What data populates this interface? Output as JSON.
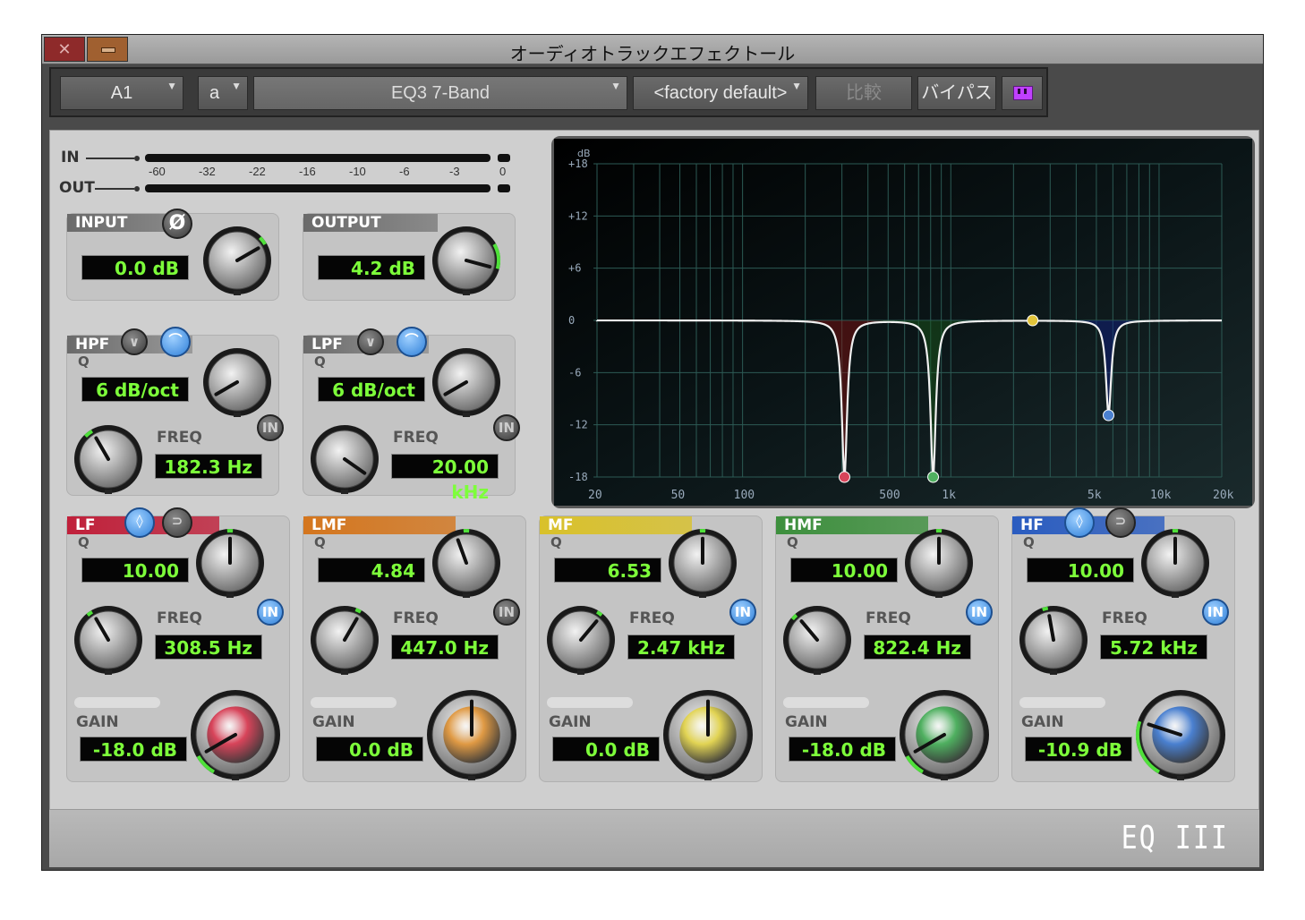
{
  "window": {
    "title": "オーディオトラックエフェクトール",
    "close_glyph": "✕"
  },
  "toolbar": {
    "track": "A1",
    "slot": "a",
    "plugin": "EQ3 7-Band",
    "preset": "<factory default>",
    "compare": "比較",
    "bypass": "バイパス"
  },
  "meter": {
    "in_label": "IN",
    "out_label": "OUT",
    "ticks": [
      "-60",
      "-32",
      "-22",
      "-16",
      "-10",
      "-6",
      "-3",
      "0"
    ]
  },
  "io": {
    "input": {
      "label": "INPUT",
      "value": "0.0 dB",
      "phase_glyph": "Ø"
    },
    "output": {
      "label": "OUTPUT",
      "value": "4.2 dB"
    }
  },
  "filters": {
    "hpf": {
      "label": "HPF",
      "q_label": "Q",
      "slope": "6 dB/oct",
      "freq_label": "FREQ",
      "freq": "182.3 Hz",
      "in_label": "IN",
      "enabled": false
    },
    "lpf": {
      "label": "LPF",
      "q_label": "Q",
      "slope": "6 dB/oct",
      "freq_label": "FREQ",
      "freq": "20.00 kHz",
      "in_label": "IN",
      "enabled": false
    }
  },
  "bands": [
    {
      "label": "LF",
      "color": "#c0203a",
      "knob": "#d8445a",
      "q_label": "Q",
      "q": "10.00",
      "freq_label": "FREQ",
      "freq": "308.5 Hz",
      "gain_label": "GAIN",
      "gain": "-18.0 dB",
      "in_label": "IN",
      "enabled": true
    },
    {
      "label": "LMF",
      "color": "#d4761e",
      "knob": "#e09a44",
      "q_label": "Q",
      "q": "4.84",
      "freq_label": "FREQ",
      "freq": "447.0 Hz",
      "gain_label": "GAIN",
      "gain": "0.0 dB",
      "in_label": "IN",
      "enabled": false
    },
    {
      "label": "MF",
      "color": "#d9c12a",
      "knob": "#e2d454",
      "q_label": "Q",
      "q": "6.53",
      "freq_label": "FREQ",
      "freq": "2.47 kHz",
      "gain_label": "GAIN",
      "gain": "0.0 dB",
      "in_label": "IN",
      "enabled": true
    },
    {
      "label": "HMF",
      "color": "#3d8f3d",
      "knob": "#4fb060",
      "q_label": "Q",
      "q": "10.00",
      "freq_label": "FREQ",
      "freq": "822.4 Hz",
      "gain_label": "GAIN",
      "gain": "-18.0 dB",
      "in_label": "IN",
      "enabled": true
    },
    {
      "label": "HF",
      "color": "#2a5cc0",
      "knob": "#4a80d0",
      "q_label": "Q",
      "q": "10.00",
      "freq_label": "FREQ",
      "freq": "5.72 kHz",
      "gain_label": "GAIN",
      "gain": "-10.9 dB",
      "in_label": "IN",
      "enabled": true
    }
  ],
  "graph": {
    "db_label": "dB",
    "y_ticks": [
      "+18",
      "+12",
      "+6",
      "0",
      "-6",
      "-12",
      "-18"
    ],
    "x_ticks": [
      "20",
      "50",
      "100",
      "500",
      "1k",
      "5k",
      "10k",
      "20k"
    ]
  },
  "logo": "EQ III"
}
